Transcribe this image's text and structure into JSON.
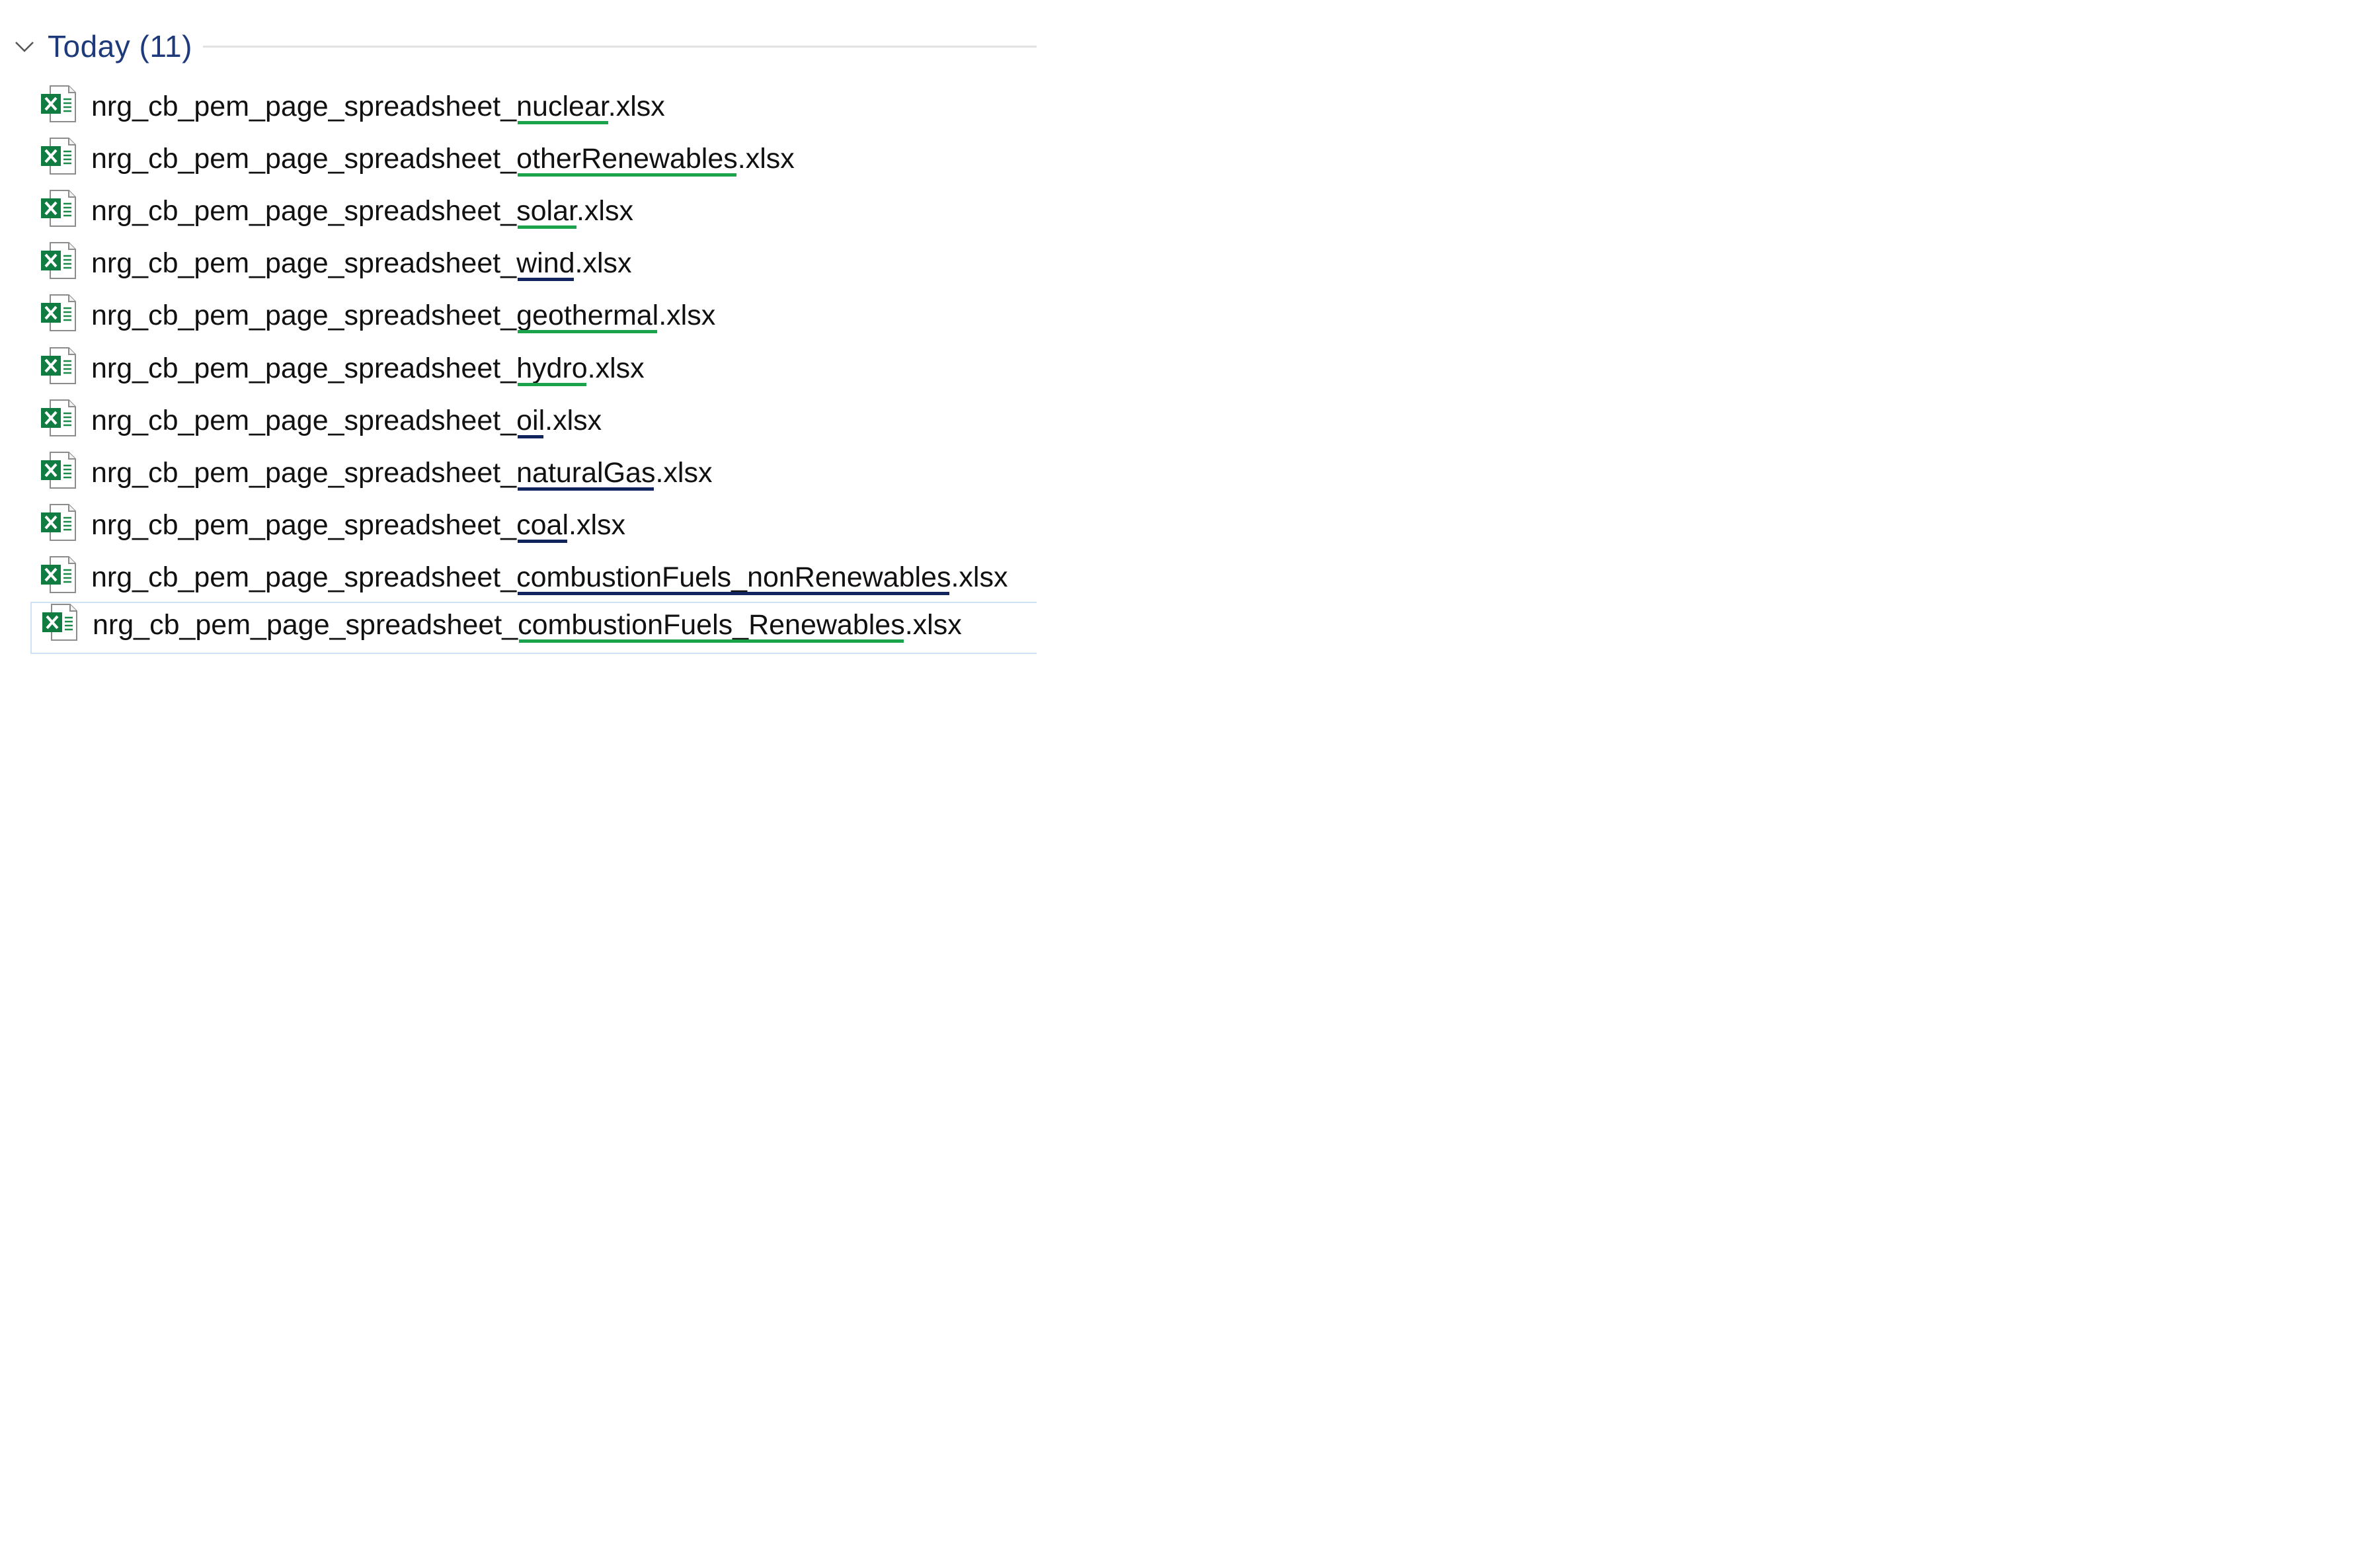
{
  "group": {
    "title": "Today (11)",
    "chevron_icon": "chevron-down-icon"
  },
  "file_icon": "excel-file-icon",
  "colors": {
    "green_underline": "#1aa34a",
    "navy_underline": "#12245e",
    "title": "#1f3a7a"
  },
  "files": [
    {
      "name": "nrg_cb_pem_page_spreadsheet_nuclear.xlsx",
      "underline": "green"
    },
    {
      "name": "nrg_cb_pem_page_spreadsheet_otherRenewables.xlsx",
      "underline": "green"
    },
    {
      "name": "nrg_cb_pem_page_spreadsheet_solar.xlsx",
      "underline": "green"
    },
    {
      "name": "nrg_cb_pem_page_spreadsheet_wind.xlsx",
      "underline": "navy"
    },
    {
      "name": "nrg_cb_pem_page_spreadsheet_geothermal.xlsx",
      "underline": "green"
    },
    {
      "name": "nrg_cb_pem_page_spreadsheet_hydro.xlsx",
      "underline": "green"
    },
    {
      "name": "nrg_cb_pem_page_spreadsheet_oil.xlsx",
      "underline": "navy"
    },
    {
      "name": "nrg_cb_pem_page_spreadsheet_naturalGas.xlsx",
      "underline": "navy"
    },
    {
      "name": "nrg_cb_pem_page_spreadsheet_coal.xlsx",
      "underline": "navy"
    },
    {
      "name": "nrg_cb_pem_page_spreadsheet_combustionFuels_nonRenewables.xlsx",
      "underline": "navy"
    },
    {
      "name": "nrg_cb_pem_page_spreadsheet_combustionFuels_Renewables.xlsx",
      "underline": "green",
      "selected": true
    }
  ]
}
